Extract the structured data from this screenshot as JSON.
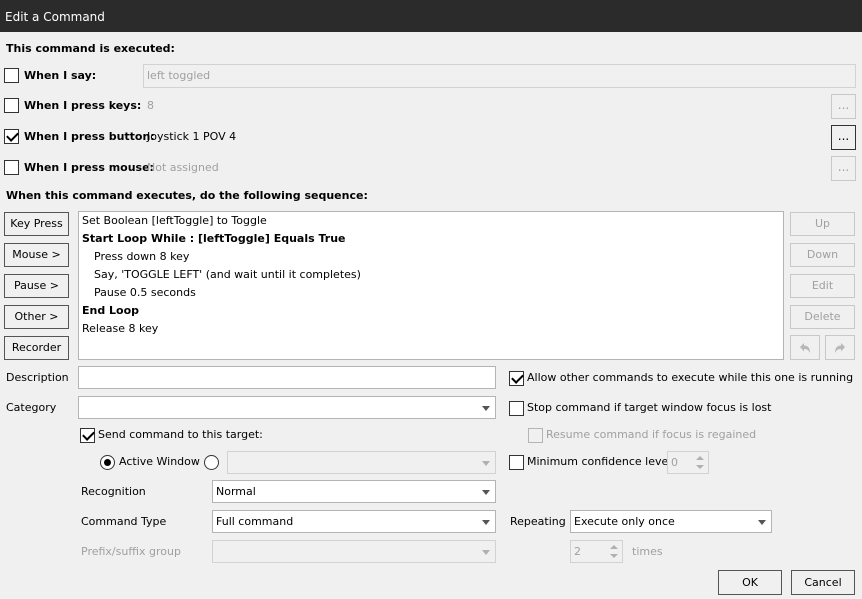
{
  "window": {
    "title": "Edit a Command"
  },
  "executed_heading": "This command is executed:",
  "triggers": {
    "say": {
      "label": "When I say:",
      "value": "left toggled",
      "checked": false
    },
    "keys": {
      "label": "When I press keys:",
      "value": "8",
      "checked": false,
      "button": "..."
    },
    "button": {
      "label": "When I press button:",
      "value": "Joystick 1 POV 4",
      "checked": true,
      "button": "..."
    },
    "mouse": {
      "label": "When I press mouse:",
      "value": "Not assigned",
      "checked": false,
      "button": "..."
    }
  },
  "sequence_heading": "When this command executes, do the following sequence:",
  "left_buttons": [
    "Key Press",
    "Mouse >",
    "Pause >",
    "Other >",
    "Recorder"
  ],
  "sequence": [
    {
      "text": "Set Boolean [leftToggle] to Toggle",
      "bold": false,
      "indent": 0
    },
    {
      "text": "Start Loop While : [leftToggle] Equals True",
      "bold": true,
      "indent": 0
    },
    {
      "text": "Press down 8 key",
      "bold": false,
      "indent": 1
    },
    {
      "text": "Say, 'TOGGLE LEFT'  (and wait until it completes)",
      "bold": false,
      "indent": 1
    },
    {
      "text": "Pause 0.5 seconds",
      "bold": false,
      "indent": 1
    },
    {
      "text": "End Loop",
      "bold": true,
      "indent": 0
    },
    {
      "text": "Release 8 key",
      "bold": false,
      "indent": 0
    }
  ],
  "right_buttons": {
    "up": "Up",
    "down": "Down",
    "edit": "Edit",
    "delete": "Delete"
  },
  "description": {
    "label": "Description",
    "value": ""
  },
  "category": {
    "label": "Category",
    "value": ""
  },
  "send_target": {
    "label": "Send command to this target:",
    "checked": true
  },
  "active_window": {
    "label": "Active Window",
    "selected": true
  },
  "target_other": {
    "value": ""
  },
  "recognition": {
    "label": "Recognition",
    "value": "Normal"
  },
  "command_type": {
    "label": "Command Type",
    "value": "Full command"
  },
  "prefix_suffix": {
    "label": "Prefix/suffix group",
    "value": ""
  },
  "options": {
    "allow_other": {
      "label": "Allow other commands to execute while this one is running",
      "checked": true
    },
    "stop_focus_lost": {
      "label": "Stop command if target window focus is lost",
      "checked": false
    },
    "resume_focus": {
      "label": "Resume command if focus is regained",
      "checked": false
    },
    "min_confidence": {
      "label": "Minimum confidence level",
      "checked": false,
      "value": "0"
    }
  },
  "repeating": {
    "label": "Repeating",
    "value": "Execute only once",
    "times_value": "2",
    "times_label": "times"
  },
  "footer": {
    "ok": "OK",
    "cancel": "Cancel"
  }
}
